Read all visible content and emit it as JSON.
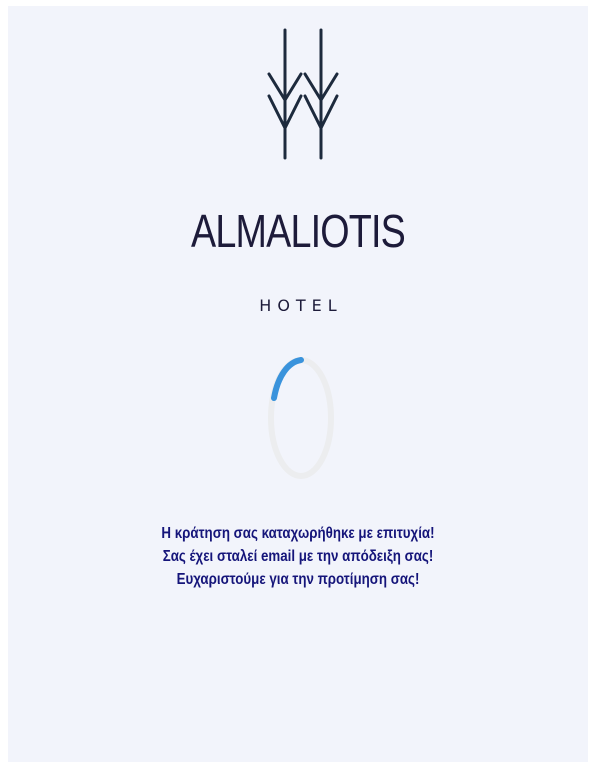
{
  "logo": {
    "icon": "double-arrow-branch-icon",
    "name": "ALMALIOTIS",
    "subtitle": "HOTEL"
  },
  "loader": {
    "icon": "loading-spinner-icon",
    "accent_color": "#3a93dc",
    "track_color": "#ecedef"
  },
  "message": {
    "line1": "Η κράτηση σας καταχωρήθηκε με επιτυχία!",
    "line2": "Σας έχει σταλεί email με την απόδειξη σας!",
    "line3": "Ευχαριστούμε για την προτίμηση σας!"
  },
  "colors": {
    "page_background": "#f2f4fb",
    "brand": "#1d1b3a",
    "message_text": "#15157a"
  }
}
